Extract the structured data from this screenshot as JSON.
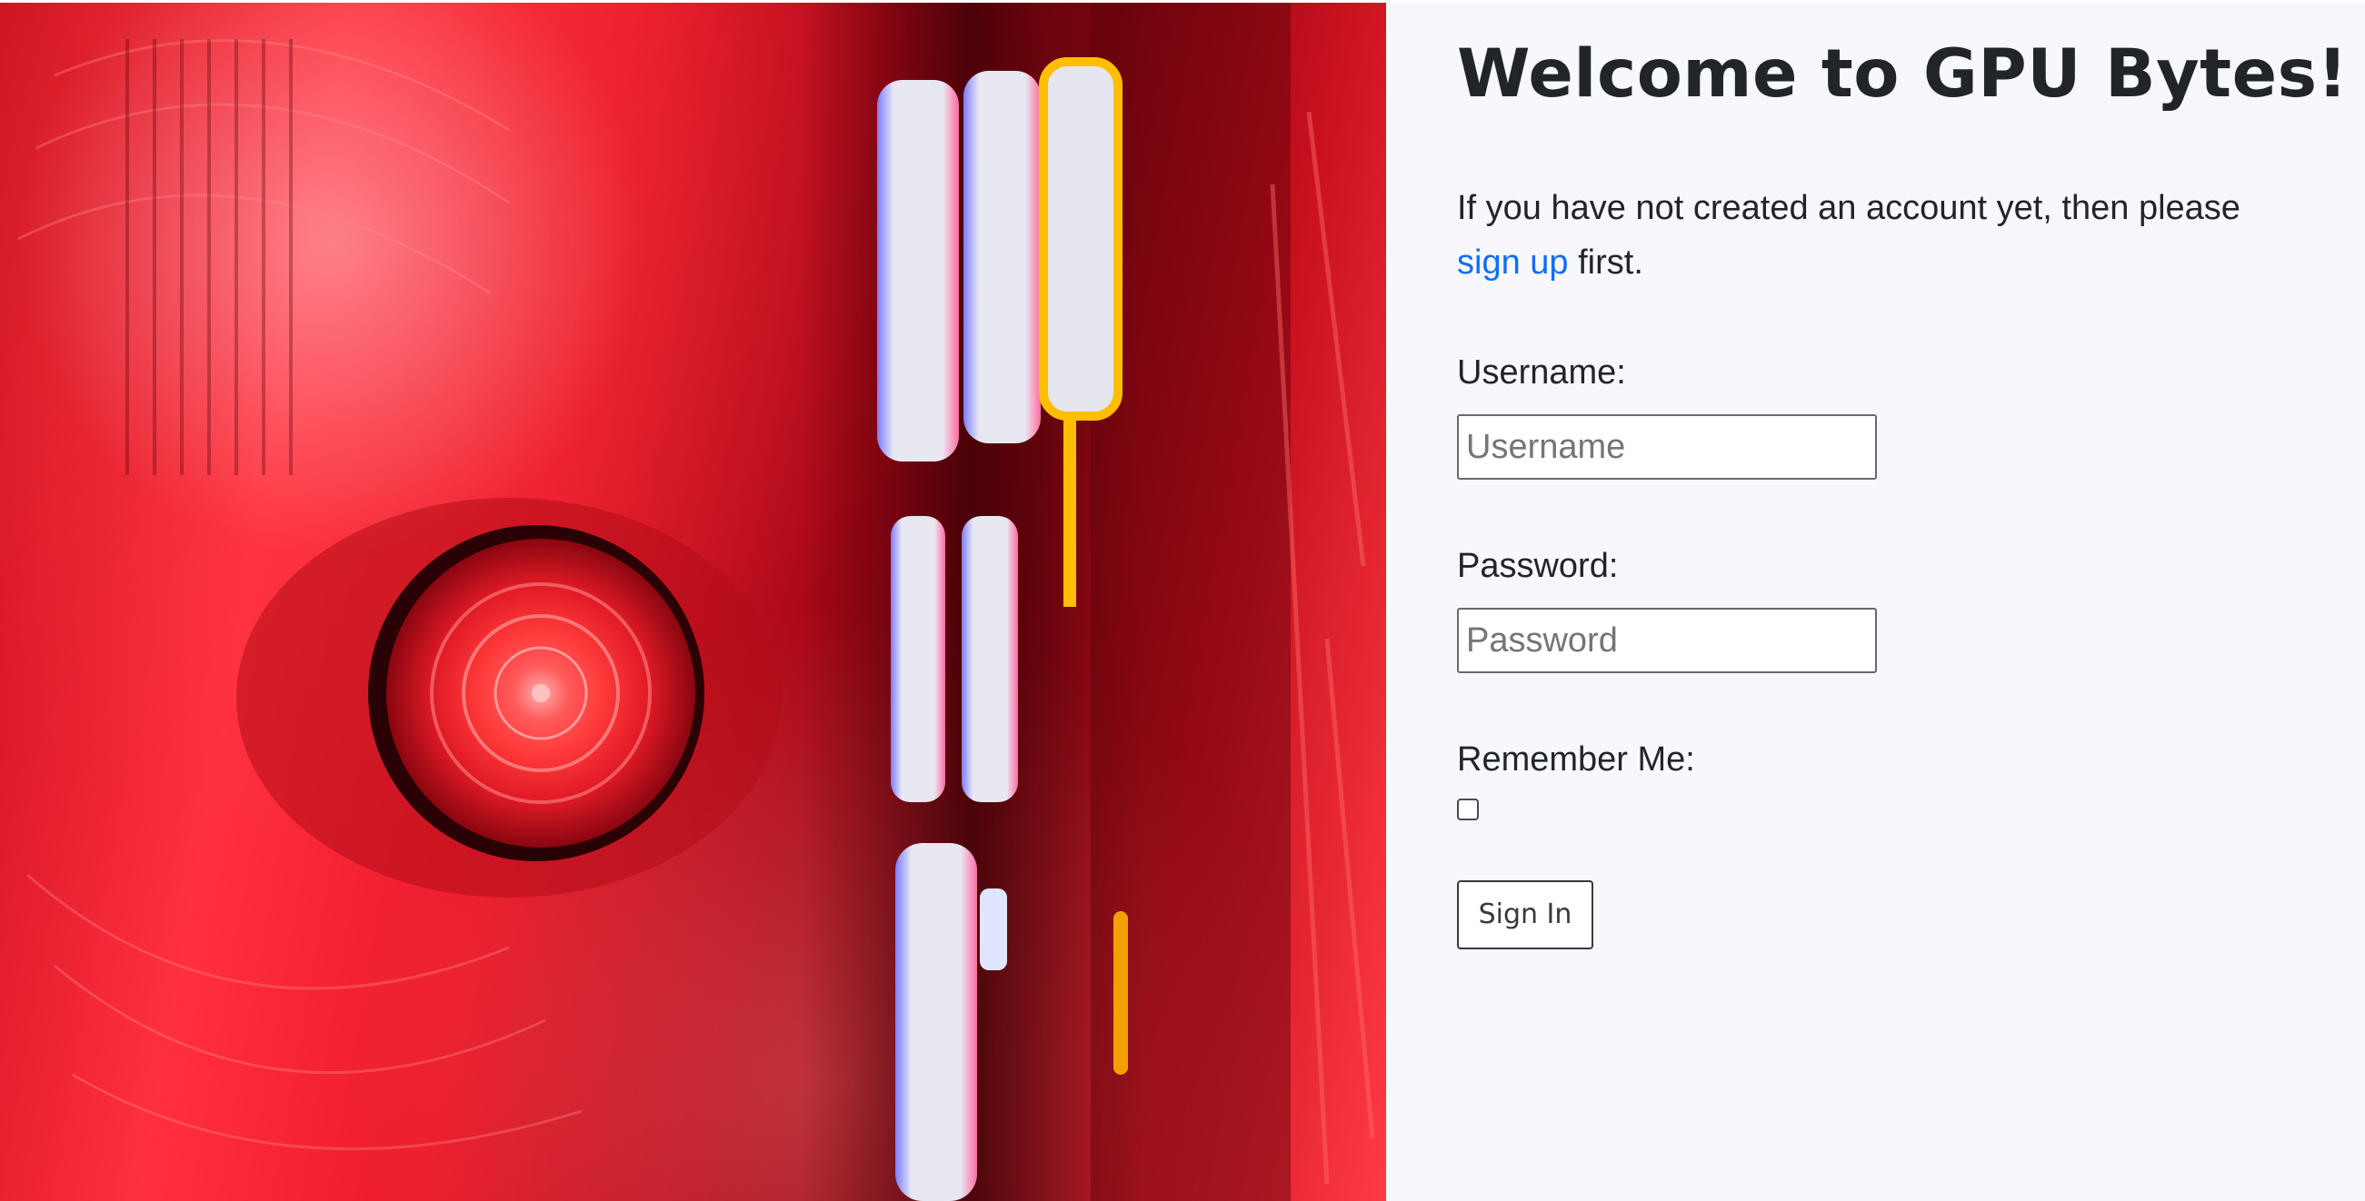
{
  "header": {
    "title": "Welcome to GPU Bytes!"
  },
  "intro": {
    "before_link": "If you have not created an account yet, then please ",
    "link_text": "sign up",
    "after_link": " first."
  },
  "form": {
    "username_label": "Username:",
    "username_placeholder": "Username",
    "username_value": "",
    "password_label": "Password:",
    "password_placeholder": "Password",
    "password_value": "",
    "remember_label": "Remember Me:",
    "remember_checked": false,
    "submit_label": "Sign In"
  },
  "hero": {
    "image_subject": "red-lit computer fan and RAM sticks"
  },
  "colors": {
    "link": "#0d6efd",
    "text": "#212529",
    "panel_background": "#f8f8fc"
  }
}
